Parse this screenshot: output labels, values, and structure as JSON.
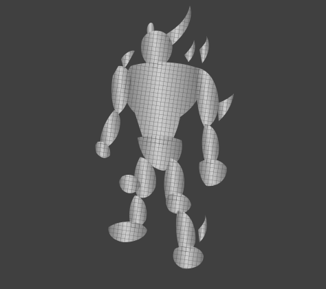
{
  "scene": {
    "background_color": "#404040",
    "mesh_fill_color": "#a9a9a9",
    "mesh_light_color": "#d0d0d0",
    "mesh_shadow_color": "#6e6e6e",
    "wire_color": "#3a3a3a",
    "subject": "wireframe-creature-model"
  }
}
